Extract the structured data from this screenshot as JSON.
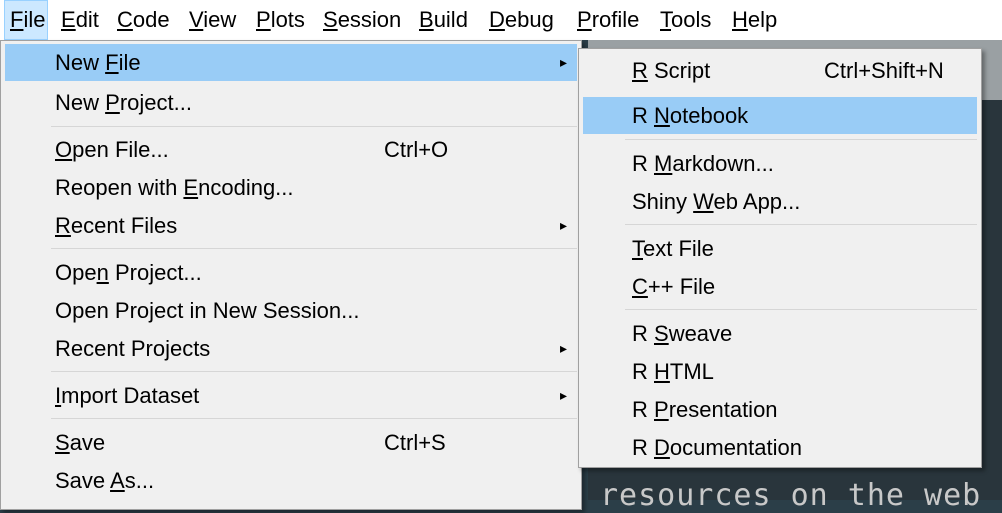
{
  "menubar": {
    "items": [
      {
        "pre": "",
        "u": "F",
        "post": "ile"
      },
      {
        "pre": "",
        "u": "E",
        "post": "dit"
      },
      {
        "pre": "",
        "u": "C",
        "post": "ode"
      },
      {
        "pre": "",
        "u": "V",
        "post": "iew"
      },
      {
        "pre": "",
        "u": "P",
        "post": "lots"
      },
      {
        "pre": "",
        "u": "S",
        "post": "ession"
      },
      {
        "pre": "",
        "u": "B",
        "post": "uild"
      },
      {
        "pre": "",
        "u": "D",
        "post": "ebug"
      },
      {
        "pre": "",
        "u": "P",
        "post": "rofile"
      },
      {
        "pre": "",
        "u": "T",
        "post": "ools"
      },
      {
        "pre": "",
        "u": "H",
        "post": "elp"
      }
    ]
  },
  "file_menu": {
    "items": [
      {
        "pre": "New ",
        "u": "F",
        "post": "ile",
        "shortcut": "",
        "submenu": true
      },
      {
        "pre": "New ",
        "u": "P",
        "post": "roject...",
        "shortcut": "",
        "submenu": false
      },
      {
        "pre": "",
        "u": "O",
        "post": "pen File...",
        "shortcut": "Ctrl+O",
        "submenu": false
      },
      {
        "pre": "Reopen with ",
        "u": "E",
        "post": "ncoding...",
        "shortcut": "",
        "submenu": false
      },
      {
        "pre": "",
        "u": "R",
        "post": "ecent Files",
        "shortcut": "",
        "submenu": true
      },
      {
        "pre": "Ope",
        "u": "n",
        "post": " Project...",
        "shortcut": "",
        "submenu": false
      },
      {
        "pre": "Open Project in New Session...",
        "u": "",
        "post": "",
        "shortcut": "",
        "submenu": false
      },
      {
        "pre": "Recent Pro",
        "u": "j",
        "post": "ects",
        "shortcut": "",
        "submenu": true
      },
      {
        "pre": "",
        "u": "I",
        "post": "mport Dataset",
        "shortcut": "",
        "submenu": true
      },
      {
        "pre": "",
        "u": "S",
        "post": "ave",
        "shortcut": "Ctrl+S",
        "submenu": false
      },
      {
        "pre": "Save ",
        "u": "A",
        "post": "s...",
        "shortcut": "",
        "submenu": false
      }
    ]
  },
  "new_file_submenu": {
    "items": [
      {
        "pre": "",
        "u": "R",
        "post": " Script",
        "shortcut": "Ctrl+Shift+N"
      },
      {
        "pre": "R ",
        "u": "N",
        "post": "otebook",
        "shortcut": ""
      },
      {
        "pre": "R ",
        "u": "M",
        "post": "arkdown...",
        "shortcut": ""
      },
      {
        "pre": "Shiny ",
        "u": "W",
        "post": "eb App...",
        "shortcut": ""
      },
      {
        "pre": "",
        "u": "T",
        "post": "ext File",
        "shortcut": ""
      },
      {
        "pre": "",
        "u": "C",
        "post": "++ File",
        "shortcut": ""
      },
      {
        "pre": "R ",
        "u": "S",
        "post": "weave",
        "shortcut": ""
      },
      {
        "pre": "R ",
        "u": "H",
        "post": "TML",
        "shortcut": ""
      },
      {
        "pre": "R ",
        "u": "P",
        "post": "resentation",
        "shortcut": ""
      },
      {
        "pre": "R ",
        "u": "D",
        "post": "ocumentation",
        "shortcut": ""
      }
    ]
  },
  "editor": {
    "visible_text": "resources on the web"
  },
  "icons": {
    "submenu_arrow": "▸"
  },
  "colors": {
    "menu_bg": "#f0f0f0",
    "highlight": "#99ccf6",
    "menubar_active": "#cce8ff",
    "editor_bg": "#29353c"
  }
}
